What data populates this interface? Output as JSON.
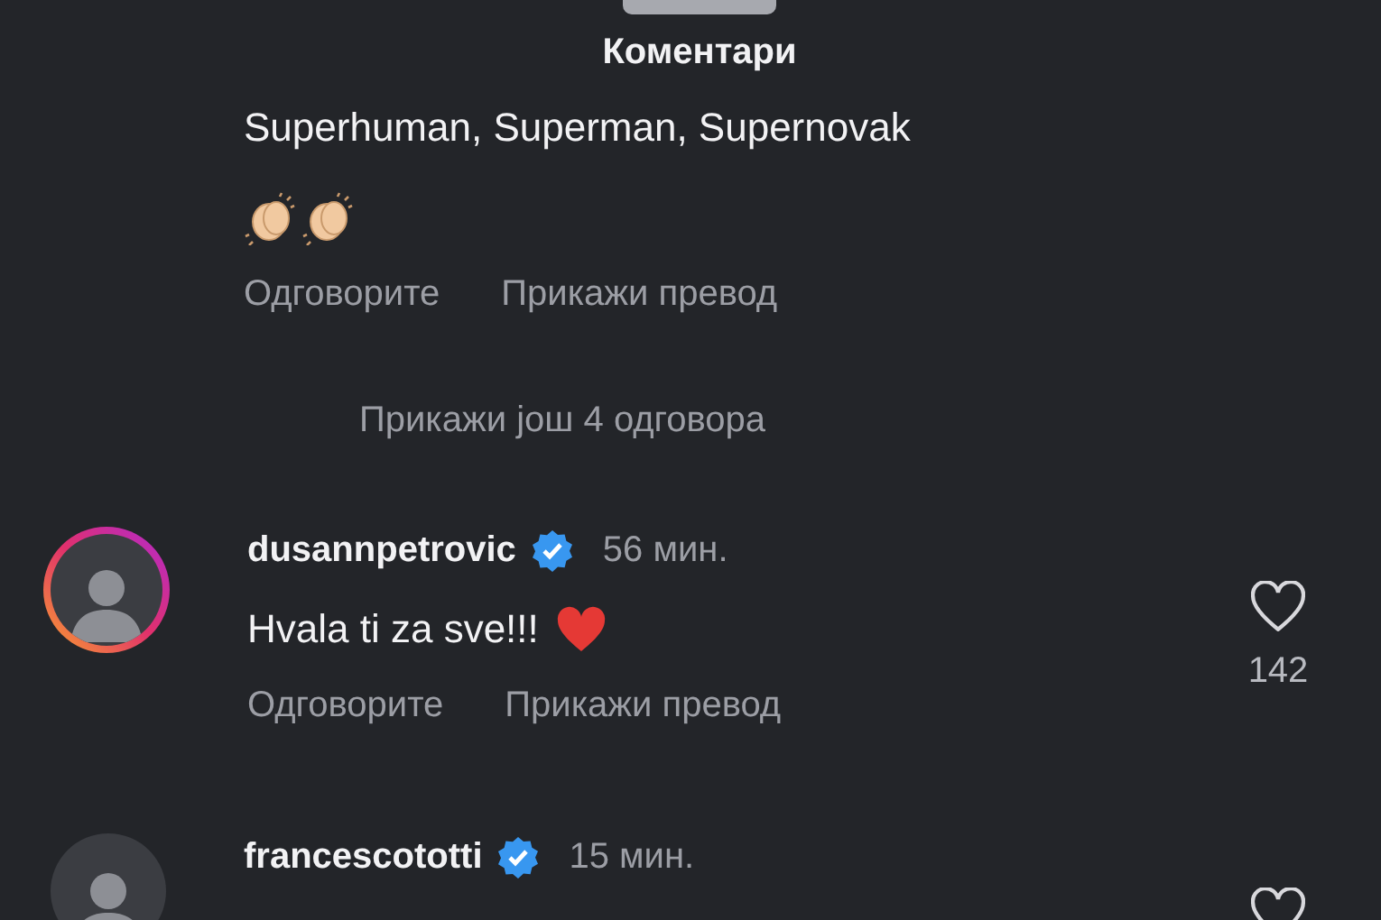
{
  "sheet": {
    "title": "Коментари"
  },
  "comments": [
    {
      "kind": "reply",
      "text": "Superhuman, Superman, Supernovak",
      "emoji": [
        {
          "kind": "clap"
        },
        {
          "kind": "clap"
        }
      ],
      "actions": [
        "Одговорите",
        "Прикажи превод"
      ]
    },
    {
      "kind": "more",
      "label": "Прикажи још 4 одговора"
    },
    {
      "kind": "comment",
      "username": "dusannpetrovic",
      "verified": true,
      "time": "56 мин.",
      "story_ring": true,
      "text": "Hvala ti za sve!!!",
      "emoji": [
        {
          "kind": "heart"
        }
      ],
      "liked": false,
      "likes": "142",
      "actions": [
        "Одговорите",
        "Прикажи превод"
      ]
    },
    {
      "kind": "comment",
      "username": "francescototti",
      "verified": true,
      "time": "15 мин.",
      "story_ring": false,
      "liked": false
    }
  ]
}
